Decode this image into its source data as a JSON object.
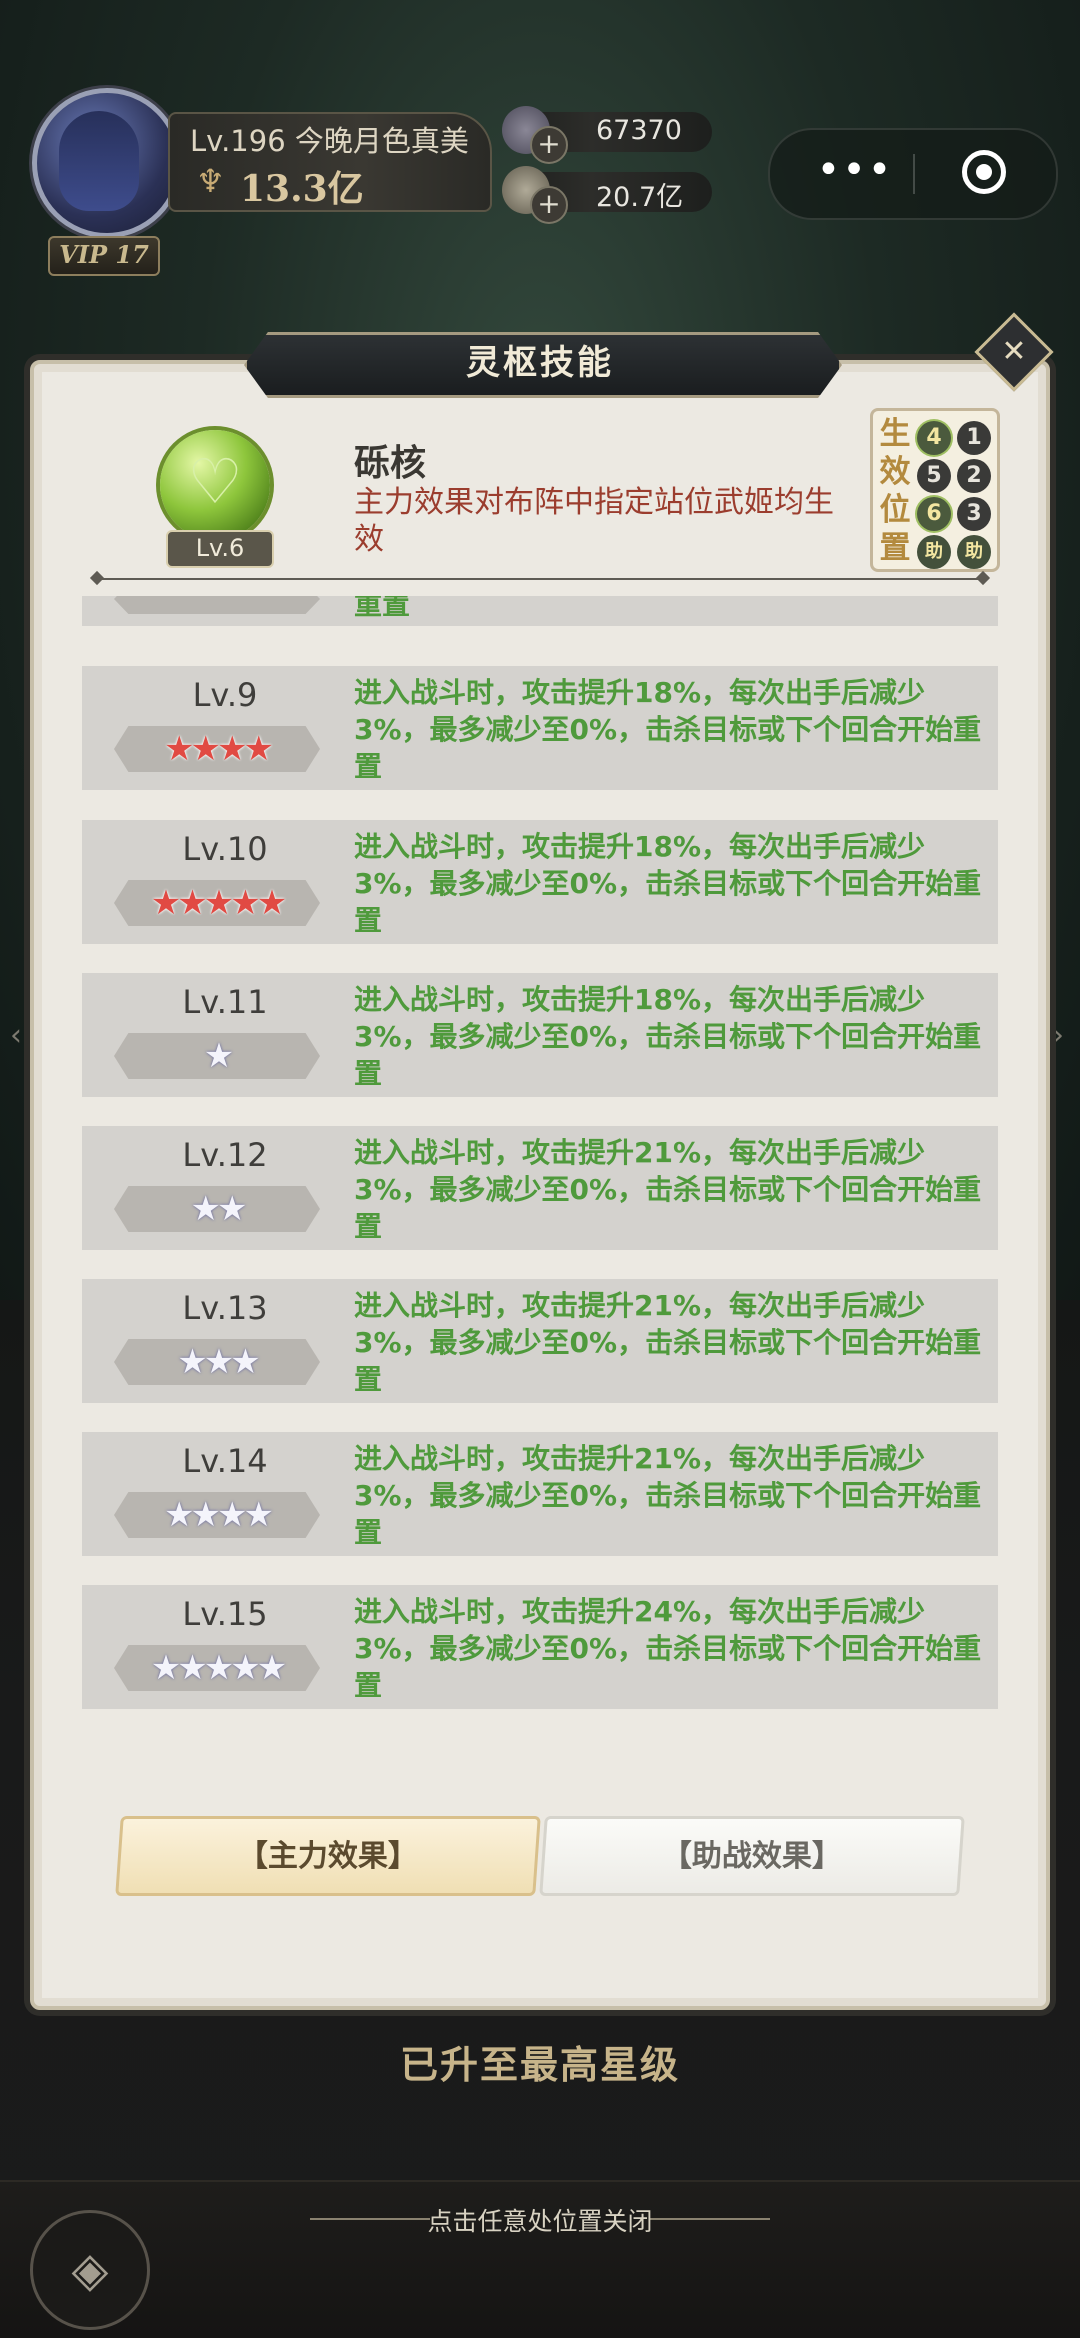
{
  "header": {
    "level_prefix": "Lv.",
    "level": "196",
    "player_name": "今晚月色真美",
    "combat_power": "13.3亿",
    "vip_label": "VIP 17",
    "resources": [
      {
        "icon": "gem-icon",
        "value": "67370"
      },
      {
        "icon": "coin-icon",
        "value": "20.7亿"
      }
    ],
    "capsule": {
      "more": "•••",
      "target": "target-icon"
    }
  },
  "panel": {
    "title": "灵枢技能",
    "skill": {
      "name": "砾核",
      "orb_level": "Lv.6",
      "description": "主力效果对布阵中指定站位武姬均生效"
    },
    "position_box": {
      "label": "生效位置",
      "cells": [
        "4",
        "1",
        "5",
        "2",
        "6",
        "3",
        "助",
        "助"
      ]
    },
    "partial_row_tail": "重置",
    "rows": [
      {
        "level": "Lv.9",
        "stars": "★★★★",
        "star_color": "red",
        "desc": "进入战斗时，攻击提升18%，每次出手后减少3%，最多减少至0%，击杀目标或下个回合开始重置"
      },
      {
        "level": "Lv.10",
        "stars": "★★★★★",
        "star_color": "red",
        "desc": "进入战斗时，攻击提升18%，每次出手后减少3%，最多减少至0%，击杀目标或下个回合开始重置"
      },
      {
        "level": "Lv.11",
        "stars": "★",
        "star_color": "silver",
        "desc": "进入战斗时，攻击提升18%，每次出手后减少3%，最多减少至0%，击杀目标或下个回合开始重置"
      },
      {
        "level": "Lv.12",
        "stars": "★★",
        "star_color": "silver",
        "desc": "进入战斗时，攻击提升21%，每次出手后减少3%，最多减少至0%，击杀目标或下个回合开始重置"
      },
      {
        "level": "Lv.13",
        "stars": "★★★",
        "star_color": "silver",
        "desc": "进入战斗时，攻击提升21%，每次出手后减少3%，最多减少至0%，击杀目标或下个回合开始重置"
      },
      {
        "level": "Lv.14",
        "stars": "★★★★",
        "star_color": "silver",
        "desc": "进入战斗时，攻击提升21%，每次出手后减少3%，最多减少至0%，击杀目标或下个回合开始重置"
      },
      {
        "level": "Lv.15",
        "stars": "★★★★★",
        "star_color": "silver",
        "desc": "进入战斗时，攻击提升24%，每次出手后减少3%，最多减少至0%，击杀目标或下个回合开始重置"
      }
    ],
    "tabs": {
      "main": "【主力效果】",
      "assist": "【助战效果】"
    }
  },
  "status_text": "已升至最高星级",
  "close_hint": "点击任意处位置关闭",
  "colors": {
    "accent_green": "#4f9a3c",
    "desc_red": "#9b3d2e",
    "star_red": "#e14a43"
  }
}
